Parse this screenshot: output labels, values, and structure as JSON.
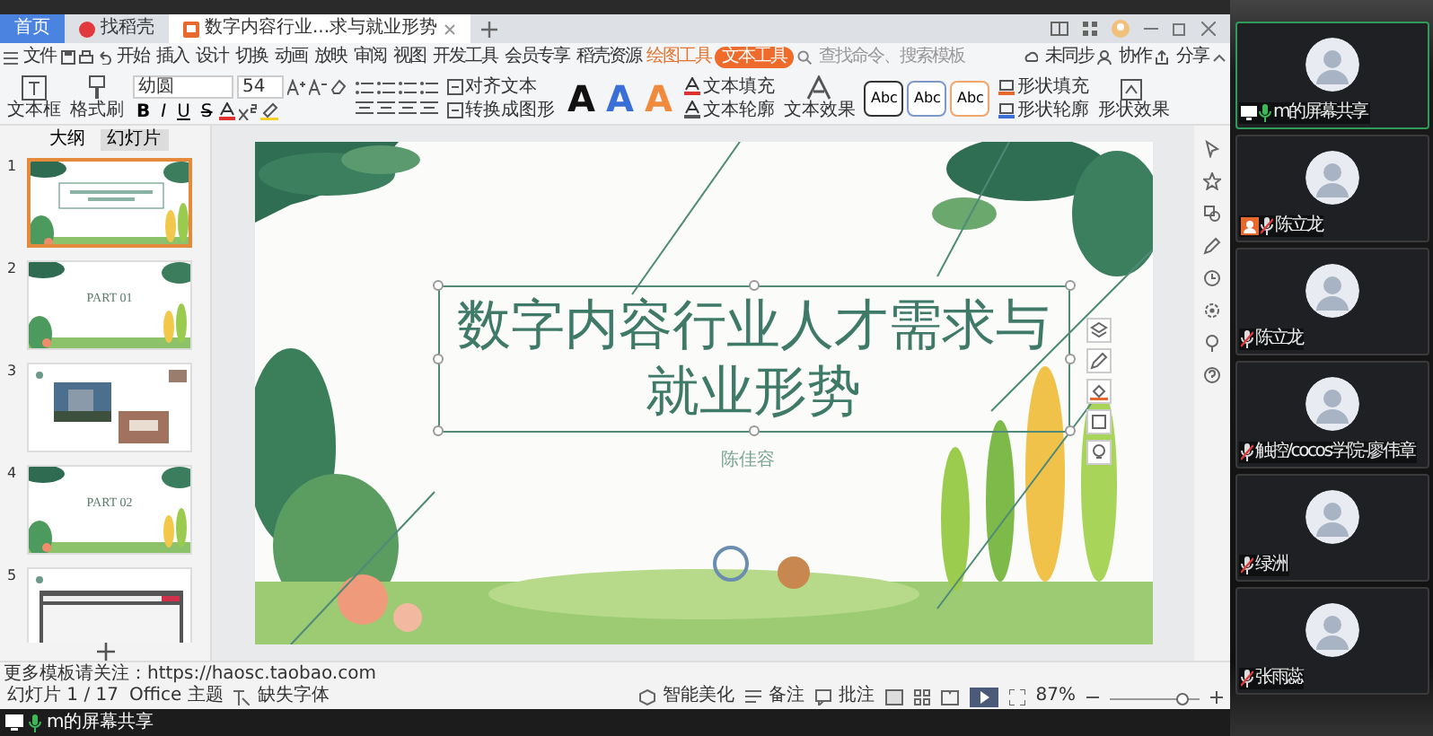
{
  "browser_tabs": [
    {
      "label": "首页",
      "selected": false,
      "kind": "home"
    },
    {
      "label": "找稻壳",
      "selected": false,
      "kind": "app"
    },
    {
      "label": "数字内容行业...求与就业形势",
      "selected": true,
      "kind": "doc"
    }
  ],
  "menu": {
    "file": "文件",
    "items": [
      {
        "label": "开始",
        "selected": false
      },
      {
        "label": "插入",
        "selected": false
      },
      {
        "label": "设计",
        "selected": false
      },
      {
        "label": "切换",
        "selected": false
      },
      {
        "label": "动画",
        "selected": false
      },
      {
        "label": "放映",
        "selected": false
      },
      {
        "label": "审阅",
        "selected": false
      },
      {
        "label": "视图",
        "selected": false
      },
      {
        "label": "开发工具",
        "selected": false
      },
      {
        "label": "会员专享",
        "selected": false
      },
      {
        "label": "稻壳资源",
        "selected": false
      }
    ],
    "context_tabs": [
      {
        "label": "绘图工具",
        "selected": false
      },
      {
        "label": "文本工具",
        "selected": true
      }
    ],
    "search": {
      "placeholder": "查找命令、搜索模板"
    },
    "actions": [
      "未同步",
      "协作",
      "分享"
    ]
  },
  "ribbon": {
    "text_box": "文本框",
    "format_painter": "格式刷",
    "font": "幼圆",
    "font_size": "54",
    "format_buttons": [
      "B",
      "I",
      "U",
      "S"
    ],
    "align_text": "对齐文本",
    "convert": "转换成图形",
    "text_styles": [
      {
        "label": "A",
        "color": "#111111"
      },
      {
        "label": "A",
        "color": "#3a6fd8"
      },
      {
        "label": "A",
        "color": "#f08a3c"
      }
    ],
    "text_fill": "文本填充",
    "text_outline": "文本轮廓",
    "text_effect": "文本效果",
    "shape_styles": [
      {
        "label": "Abc",
        "color": "#333333"
      },
      {
        "label": "Abc",
        "color": "#7d97c9"
      },
      {
        "label": "Abc",
        "color": "#f0a66a"
      }
    ],
    "shape_fill": "形状填充",
    "shape_outline": "形状轮廓",
    "shape_effect": "形状效果"
  },
  "side_panel": {
    "tabs": [
      {
        "label": "大纲",
        "selected": false
      },
      {
        "label": "幻灯片",
        "selected": true
      }
    ],
    "slides": [
      {
        "number": "1",
        "selected": true,
        "kind": "title"
      },
      {
        "number": "2",
        "selected": false,
        "kind": "part",
        "title": "PART 01"
      },
      {
        "number": "3",
        "selected": false,
        "kind": "photos"
      },
      {
        "number": "4",
        "selected": false,
        "kind": "part",
        "title": "PART 02"
      },
      {
        "number": "5",
        "selected": false,
        "kind": "web"
      }
    ]
  },
  "slide": {
    "title": "数字内容行业人才需求与就业形势",
    "author": "陈佳容"
  },
  "notes": "更多模板请关注：https://haosc.taobao.com",
  "status_bar": {
    "slide_count": "幻灯片 1 / 17",
    "theme": "Office 主题",
    "missing_fonts": "缺失字体",
    "beautify": "智能美化",
    "notes": "备注",
    "comments": "批注",
    "zoom": "87%",
    "level": 0.8
  },
  "share_bar": {
    "label": "m的屏幕共享"
  },
  "participants": [
    {
      "name": "m的屏幕共享",
      "selected": true,
      "muted": false,
      "sharing": true,
      "host": false
    },
    {
      "name": "陈立龙",
      "selected": false,
      "muted": true,
      "sharing": false,
      "host": true
    },
    {
      "name": "陈立龙",
      "selected": false,
      "muted": true,
      "sharing": false,
      "host": false
    },
    {
      "name": "触控/cocos学院-廖伟章",
      "selected": false,
      "muted": true,
      "sharing": false,
      "host": false
    },
    {
      "name": "绿洲",
      "selected": false,
      "muted": true,
      "sharing": false,
      "host": false
    },
    {
      "name": "张雨蕊",
      "selected": false,
      "muted": true,
      "sharing": false,
      "host": false
    }
  ]
}
